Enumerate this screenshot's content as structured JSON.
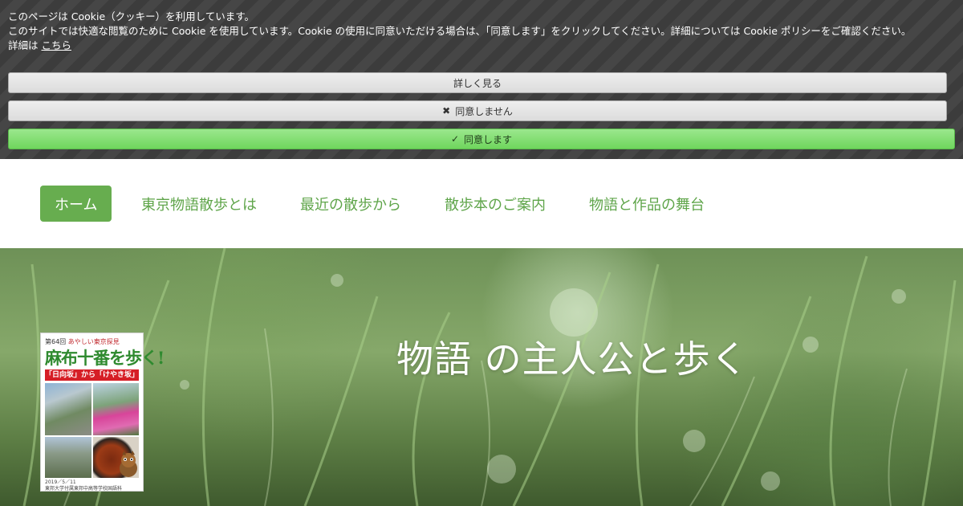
{
  "cookie_banner": {
    "line1": "このページは Cookie（クッキー）を利用しています。",
    "line2": "このサイトでは快適な閲覧のために Cookie を使用しています。Cookie の使用に同意いただける場合は、「同意します」をクリックしてください。詳細については Cookie ポリシーをご確認ください。",
    "line3_prefix": "詳細は",
    "line3_link": "こちら",
    "btn_more": "詳しく見る",
    "btn_deny_icon": "✖",
    "btn_deny": "同意しません",
    "btn_agree_icon": "✓",
    "btn_agree": "同意します"
  },
  "nav": {
    "items": [
      {
        "label": "ホーム",
        "active": true
      },
      {
        "label": "東京物語散歩とは",
        "active": false
      },
      {
        "label": "最近の散歩から",
        "active": false
      },
      {
        "label": "散歩本のご案内",
        "active": false
      },
      {
        "label": "物語と作品の舞台",
        "active": false
      }
    ]
  },
  "hero": {
    "title": "物語 の主人公と歩く"
  },
  "poster": {
    "issue": "第64回",
    "series": "あやしい東京探見",
    "title": "麻布十番を歩く!",
    "subtitle": "「日向坂」から「けやき坂」へ",
    "date": "2019／5／11",
    "org": "東邦大学付属東邦中高等学校国語科"
  },
  "colors": {
    "accent_green": "#67ad4f",
    "nav_text": "#5fa54a",
    "agree_button": "#7ddc6b",
    "poster_red": "#d61e26"
  }
}
